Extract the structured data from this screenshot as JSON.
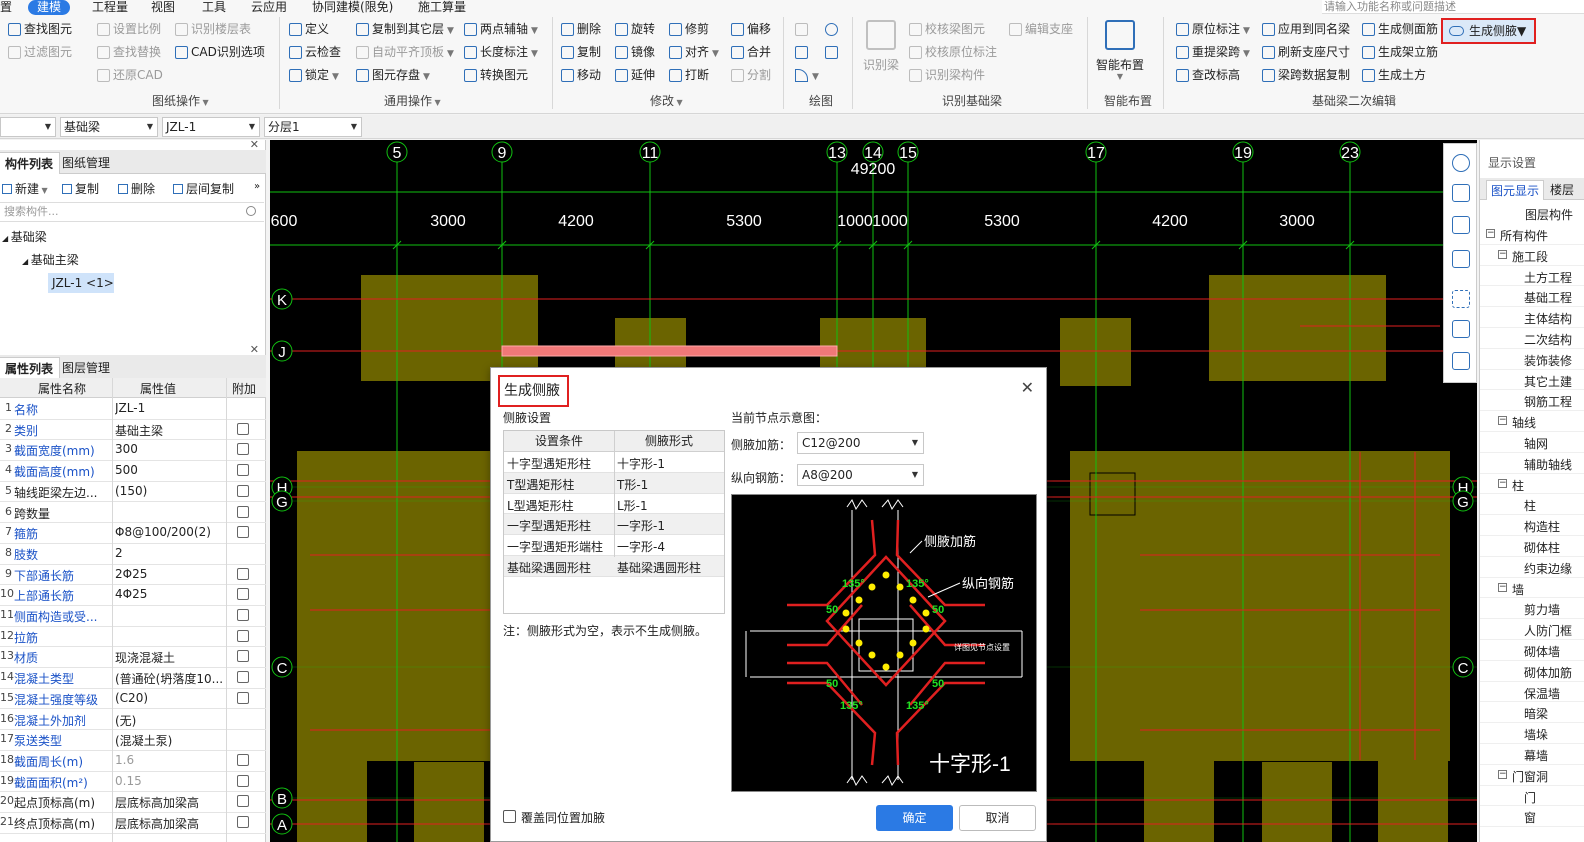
{
  "menu": {
    "items": [
      {
        "label": "置",
        "active": false
      },
      {
        "label": "建模",
        "active": true
      },
      {
        "label": "工程量",
        "active": false
      },
      {
        "label": "视图",
        "active": false
      },
      {
        "label": "工具",
        "active": false
      },
      {
        "label": "云应用",
        "active": false
      },
      {
        "label": "协同建模(限免)",
        "active": false
      },
      {
        "label": "施工算量",
        "active": false
      }
    ],
    "search_placeholder": "请输入功能名称或问题描述"
  },
  "ribbon": {
    "drawing_ops": {
      "group_label": "图纸操作",
      "buttons": [
        "查找图元",
        "过滤图元",
        "设置比例",
        "查找替换",
        "还原CAD",
        "识别楼层表",
        "CAD识别选项"
      ]
    },
    "general_ops": {
      "group_label": "通用操作",
      "buttons": [
        "定义",
        "云检查",
        "锁定",
        "复制到其它层",
        "自动平齐顶板",
        "图元存盘",
        "两点辅轴",
        "长度标注",
        "转换图元"
      ]
    },
    "modify": {
      "group_label": "修改",
      "buttons": [
        "删除",
        "复制",
        "移动",
        "旋转",
        "镜像",
        "延伸",
        "修剪",
        "对齐",
        "打断",
        "偏移",
        "合并",
        "分割"
      ]
    },
    "draw": {
      "group_label": "绘图"
    },
    "recognize": {
      "group_label": "识别基础梁",
      "big_button": "识别梁",
      "buttons": [
        "校核梁图元",
        "校核原位标注",
        "识别梁构件",
        "编辑支座"
      ]
    },
    "smart": {
      "group_label": "智能布置",
      "big_button": "智能布置"
    },
    "secondary": {
      "group_label": "基础梁二次编辑",
      "buttons": [
        "原位标注",
        "重提梁跨",
        "查改标高",
        "应用到同名梁",
        "刷新支座尺寸",
        "梁跨数据复制",
        "生成侧面筋",
        "生成架立筋",
        "生成土方"
      ],
      "highlight_button": "生成侧腋"
    }
  },
  "selectors": [
    "基础梁",
    "JZL-1",
    "分层1"
  ],
  "component_panel": {
    "tabs": [
      "构件列表",
      "图纸管理"
    ],
    "toolbar": [
      "新建",
      "复制",
      "删除",
      "层间复制"
    ],
    "search_placeholder": "搜索构件...",
    "tree": {
      "root": "基础梁",
      "child": "基础主梁",
      "leaf": "JZL-1 <1>"
    }
  },
  "property_panel": {
    "tabs": [
      "属性列表",
      "图层管理"
    ],
    "headers": {
      "name": "属性名称",
      "value": "属性值",
      "extra": "附加"
    },
    "rows": [
      {
        "num": "1",
        "name": "名称",
        "value": "JZL-1",
        "blue": true,
        "check": false,
        "gray": false
      },
      {
        "num": "2",
        "name": "类别",
        "value": "基础主梁",
        "blue": true,
        "check": true,
        "gray": false
      },
      {
        "num": "3",
        "name": "截面宽度(mm)",
        "value": "300",
        "blue": true,
        "check": true,
        "gray": false
      },
      {
        "num": "4",
        "name": "截面高度(mm)",
        "value": "500",
        "blue": true,
        "check": true,
        "gray": false
      },
      {
        "num": "5",
        "name": "轴线距梁左边...",
        "value": "(150)",
        "blue": false,
        "check": true,
        "gray": false
      },
      {
        "num": "6",
        "name": "跨数量",
        "value": "",
        "blue": false,
        "check": true,
        "gray": false
      },
      {
        "num": "7",
        "name": "箍筋",
        "value": "Φ8@100/200(2)",
        "blue": true,
        "check": true,
        "gray": false
      },
      {
        "num": "8",
        "name": "肢数",
        "value": "2",
        "blue": true,
        "check": false,
        "gray": false
      },
      {
        "num": "9",
        "name": "下部通长筋",
        "value": "2Φ25",
        "blue": true,
        "check": true,
        "gray": false
      },
      {
        "num": "10",
        "name": "上部通长筋",
        "value": "4Φ25",
        "blue": true,
        "check": true,
        "gray": false
      },
      {
        "num": "11",
        "name": "侧面构造或受...",
        "value": "",
        "blue": true,
        "check": true,
        "gray": false
      },
      {
        "num": "12",
        "name": "拉筋",
        "value": "",
        "blue": true,
        "check": true,
        "gray": false
      },
      {
        "num": "13",
        "name": "材质",
        "value": "现浇混凝土",
        "blue": true,
        "check": true,
        "gray": false
      },
      {
        "num": "14",
        "name": "混凝土类型",
        "value": "(普通砼(坍落度10...",
        "blue": true,
        "check": true,
        "gray": false
      },
      {
        "num": "15",
        "name": "混凝土强度等级",
        "value": "(C20)",
        "blue": true,
        "check": true,
        "gray": false
      },
      {
        "num": "16",
        "name": "混凝土外加剂",
        "value": "(无)",
        "blue": true,
        "check": false,
        "gray": false
      },
      {
        "num": "17",
        "name": "泵送类型",
        "value": "(混凝土泵)",
        "blue": true,
        "check": false,
        "gray": false
      },
      {
        "num": "18",
        "name": "截面周长(m)",
        "value": "1.6",
        "blue": true,
        "check": true,
        "gray": true
      },
      {
        "num": "19",
        "name": "截面面积(m²)",
        "value": "0.15",
        "blue": true,
        "check": true,
        "gray": true
      },
      {
        "num": "20",
        "name": "起点顶标高(m)",
        "value": "层底标高加梁高",
        "blue": false,
        "check": true,
        "gray": false
      },
      {
        "num": "21",
        "name": "终点顶标高(m)",
        "value": "层底标高加梁高",
        "blue": false,
        "check": true,
        "gray": false
      }
    ]
  },
  "canvas": {
    "total_dim": "49200",
    "axes_top": [
      "5",
      "9",
      "11",
      "13",
      "14",
      "15",
      "17",
      "19",
      "23"
    ],
    "dims": [
      "600",
      "3000",
      "4200",
      "5300",
      "1000",
      "1000",
      "5300",
      "4200",
      "3000"
    ],
    "axes_left": [
      "K",
      "J",
      "H",
      "G",
      "C",
      "B",
      "A"
    ],
    "colors": {
      "grid_green": "#11c011",
      "beam_red": "#e02020",
      "pad_olive": "#6b6400",
      "selected_beam": "#f07878"
    }
  },
  "display_panel": {
    "title": "显示设置",
    "tabs": [
      "图元显示",
      "楼层"
    ],
    "header": "图层构件",
    "rows": [
      {
        "label": "所有构件",
        "level": 0,
        "expand": true
      },
      {
        "label": "施工段",
        "level": 1,
        "expand": true
      },
      {
        "label": "土方工程",
        "level": 2,
        "expand": false
      },
      {
        "label": "基础工程",
        "level": 2,
        "expand": false
      },
      {
        "label": "主体结构",
        "level": 2,
        "expand": false
      },
      {
        "label": "二次结构",
        "level": 2,
        "expand": false
      },
      {
        "label": "装饰装修",
        "level": 2,
        "expand": false
      },
      {
        "label": "其它土建",
        "level": 2,
        "expand": false
      },
      {
        "label": "钢筋工程",
        "level": 2,
        "expand": false
      },
      {
        "label": "轴线",
        "level": 1,
        "expand": true
      },
      {
        "label": "轴网",
        "level": 2,
        "expand": false
      },
      {
        "label": "辅助轴线",
        "level": 2,
        "expand": false
      },
      {
        "label": "柱",
        "level": 1,
        "expand": true
      },
      {
        "label": "柱",
        "level": 2,
        "expand": false
      },
      {
        "label": "构造柱",
        "level": 2,
        "expand": false
      },
      {
        "label": "砌体柱",
        "level": 2,
        "expand": false
      },
      {
        "label": "约束边缘",
        "level": 2,
        "expand": false
      },
      {
        "label": "墙",
        "level": 1,
        "expand": true
      },
      {
        "label": "剪力墙",
        "level": 2,
        "expand": false
      },
      {
        "label": "人防门框",
        "level": 2,
        "expand": false
      },
      {
        "label": "砌体墙",
        "level": 2,
        "expand": false
      },
      {
        "label": "砌体加筋",
        "level": 2,
        "expand": false
      },
      {
        "label": "保温墙",
        "level": 2,
        "expand": false
      },
      {
        "label": "暗梁",
        "level": 2,
        "expand": false
      },
      {
        "label": "墙垛",
        "level": 2,
        "expand": false
      },
      {
        "label": "幕墙",
        "level": 2,
        "expand": false
      },
      {
        "label": "门窗洞",
        "level": 1,
        "expand": true
      },
      {
        "label": "门",
        "level": 2,
        "expand": false
      },
      {
        "label": "窗",
        "level": 2,
        "expand": false
      }
    ]
  },
  "dialog": {
    "title": "生成侧腋",
    "section_settings": "侧腋设置",
    "table_headers": [
      "设置条件",
      "侧腋形式"
    ],
    "table_rows": [
      {
        "condition": "十字型遇矩形柱",
        "form": "十字形-1"
      },
      {
        "condition": "T型遇矩形柱",
        "form": "T形-1"
      },
      {
        "condition": "L型遇矩形柱",
        "form": "L形-1"
      },
      {
        "condition": "一字型遇矩形柱",
        "form": "一字形-1"
      },
      {
        "condition": "一字型遇矩形端柱",
        "form": "一字形-4"
      },
      {
        "condition": "基础梁遇圆形柱",
        "form": "基础梁遇圆形柱"
      }
    ],
    "note": "注：侧腋形式为空，表示不生成侧腋。",
    "section_diagram": "当前节点示意图：",
    "haunch_rebar_label": "侧腋加筋：",
    "haunch_rebar_value": "C12@200",
    "long_rebar_label": "纵向钢筋：",
    "long_rebar_value": "A8@200",
    "diagram": {
      "label_haunch": "侧腋加筋",
      "label_long": "纵向钢筋",
      "label_node": "详图见节点设置",
      "label_135": "135°",
      "label_50": "50",
      "caption": "十字形-1"
    },
    "override_checkbox": "覆盖同位置加腋",
    "ok": "确定",
    "cancel": "取消"
  }
}
